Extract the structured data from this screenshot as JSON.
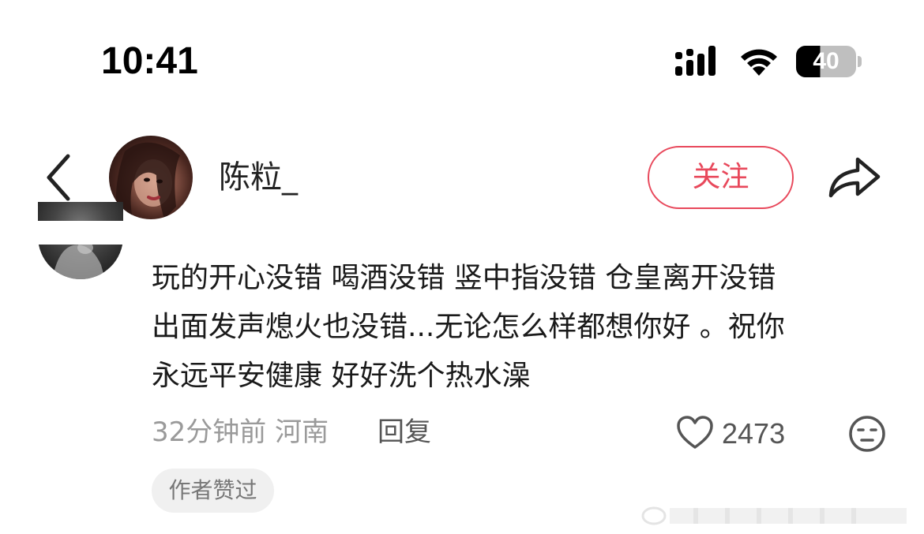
{
  "status_bar": {
    "time": "10:41",
    "battery": "40",
    "signal_icon": "signal-bars-icon",
    "wifi_icon": "wifi-icon"
  },
  "header": {
    "back_icon": "chevron-left-icon",
    "username": "陈粒_",
    "follow_label": "关注",
    "share_icon": "share-arrow-icon"
  },
  "comment": {
    "lines": [
      "玩的开心没错 喝酒没错 竖中指没错 仓皇离开没错",
      "出面发声熄火也没错...无论怎么样都想你好 。祝你",
      "永远平安健康 好好洗个热水澡"
    ],
    "meta": "32分钟前 河南",
    "reply_label": "回复",
    "like_count": "2473",
    "author_liked_label": "作者赞过"
  },
  "colors": {
    "accent": "#e8485b",
    "text_primary": "#1a1a1a",
    "text_secondary": "#9a9a9a",
    "badge_bg": "#f0f0f0"
  }
}
